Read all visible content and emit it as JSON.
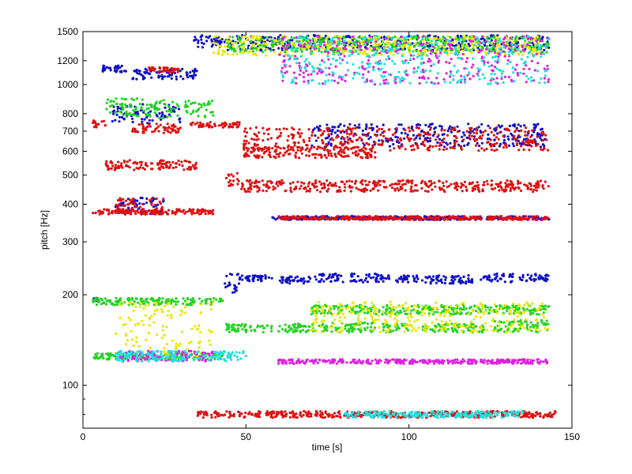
{
  "chart_data": {
    "type": "scatter",
    "title": "",
    "xlabel": "time [s]",
    "ylabel": "pitch [Hz]",
    "xlim": [
      0,
      150
    ],
    "ylim": [
      72,
      1500
    ],
    "yscale": "log",
    "grid": false,
    "legend": "none",
    "x_ticks": [
      0,
      50,
      100,
      150
    ],
    "y_ticks": [
      100,
      200,
      300,
      400,
      500,
      600,
      700,
      800,
      1000,
      1200,
      1500
    ],
    "colors": {
      "blue": "#1010c8",
      "red": "#e01010",
      "green": "#22d422",
      "yellow": "#e8e800",
      "magenta": "#e020e0",
      "cyan": "#20e0e0"
    },
    "series": [
      {
        "color": "blue",
        "segments": [
          {
            "t": [
              3,
              5
            ],
            "f": [
              190,
              195
            ]
          },
          {
            "t": [
              43,
              48
            ],
            "f": [
              200,
              240
            ]
          },
          {
            "t": [
              48,
              58
            ],
            "f": [
              222,
              232
            ]
          },
          {
            "t": [
              60,
              70
            ],
            "f": [
              218,
              230
            ]
          },
          {
            "t": [
              71,
              80
            ],
            "f": [
              220,
              235
            ]
          },
          {
            "t": [
              82,
              94
            ],
            "f": [
              220,
              235
            ]
          },
          {
            "t": [
              96,
              103
            ],
            "f": [
              220,
              232
            ]
          },
          {
            "t": [
              104,
              120
            ],
            "f": [
              218,
              232
            ]
          },
          {
            "t": [
              122,
              132
            ],
            "f": [
              220,
              235
            ]
          },
          {
            "t": [
              134,
              143
            ],
            "f": [
              222,
              235
            ]
          },
          {
            "t": [
              6,
              14
            ],
            "f": [
              1100,
              1160
            ]
          },
          {
            "t": [
              15,
              35
            ],
            "f": [
              1040,
              1130
            ]
          },
          {
            "t": [
              34,
              46
            ],
            "f": [
              1330,
              1460
            ]
          },
          {
            "t": [
              44,
              143
            ],
            "f": [
              1300,
              1460
            ]
          },
          {
            "t": [
              9,
              30
            ],
            "f": [
              740,
              860
            ]
          },
          {
            "t": [
              10,
              25
            ],
            "f": [
              370,
              420
            ]
          },
          {
            "t": [
              70,
              142
            ],
            "f": [
              620,
              740
            ]
          },
          {
            "t": [
              58,
              143
            ],
            "f": [
              355,
              365
            ]
          }
        ]
      },
      {
        "color": "red",
        "segments": [
          {
            "t": [
              3,
              40
            ],
            "f": [
              370,
              385
            ]
          },
          {
            "t": [
              10,
              25
            ],
            "f": [
              370,
              420
            ]
          },
          {
            "t": [
              7,
              35
            ],
            "f": [
              520,
              560
            ]
          },
          {
            "t": [
              3,
              7
            ],
            "f": [
              720,
              760
            ]
          },
          {
            "t": [
              15,
              30
            ],
            "f": [
              690,
              740
            ]
          },
          {
            "t": [
              33,
              48
            ],
            "f": [
              720,
              750
            ]
          },
          {
            "t": [
              44,
              48
            ],
            "f": [
              460,
              520
            ]
          },
          {
            "t": [
              48,
              143
            ],
            "f": [
              440,
              480
            ]
          },
          {
            "t": [
              49,
              143
            ],
            "f": [
              600,
              720
            ]
          },
          {
            "t": [
              49,
              90
            ],
            "f": [
              570,
              620
            ]
          },
          {
            "t": [
              20,
              30
            ],
            "f": [
              1100,
              1140
            ]
          },
          {
            "t": [
              60,
              143
            ],
            "f": [
              355,
              365
            ]
          },
          {
            "t": [
              35,
              145
            ],
            "f": [
              78,
              82
            ]
          }
        ]
      },
      {
        "color": "green",
        "segments": [
          {
            "t": [
              3,
              43
            ],
            "f": [
              185,
              195
            ]
          },
          {
            "t": [
              3,
              43
            ],
            "f": [
              122,
              128
            ]
          },
          {
            "t": [
              44,
              58
            ],
            "f": [
              150,
              160
            ]
          },
          {
            "t": [
              60,
              75
            ],
            "f": [
              150,
              160
            ]
          },
          {
            "t": [
              76,
              90
            ],
            "f": [
              150,
              162
            ]
          },
          {
            "t": [
              92,
              100
            ],
            "f": [
              150,
              160
            ]
          },
          {
            "t": [
              104,
              123
            ],
            "f": [
              150,
              160
            ]
          },
          {
            "t": [
              126,
              143
            ],
            "f": [
              150,
              165
            ]
          },
          {
            "t": [
              70,
              143
            ],
            "f": [
              172,
              185
            ]
          },
          {
            "t": [
              7,
              40
            ],
            "f": [
              770,
              900
            ]
          },
          {
            "t": [
              44,
              143
            ],
            "f": [
              1280,
              1450
            ]
          }
        ]
      },
      {
        "color": "yellow",
        "segments": [
          {
            "t": [
              10,
              40
            ],
            "f": [
              125,
              190
            ]
          },
          {
            "t": [
              70,
              143
            ],
            "f": [
              150,
              190
            ]
          },
          {
            "t": [
              40,
              140
            ],
            "f": [
              1250,
              1450
            ]
          }
        ]
      },
      {
        "color": "magenta",
        "segments": [
          {
            "t": [
              10,
              40
            ],
            "f": [
              120,
              130
            ]
          },
          {
            "t": [
              60,
              143
            ],
            "f": [
              118,
              122
            ]
          },
          {
            "t": [
              60,
              143
            ],
            "f": [
              1000,
              1450
            ]
          }
        ]
      },
      {
        "color": "cyan",
        "segments": [
          {
            "t": [
              10,
              50
            ],
            "f": [
              120,
              130
            ]
          },
          {
            "t": [
              60,
              143
            ],
            "f": [
              1000,
              1450
            ]
          },
          {
            "t": [
              80,
              135
            ],
            "f": [
              78,
              82
            ]
          }
        ]
      }
    ]
  }
}
